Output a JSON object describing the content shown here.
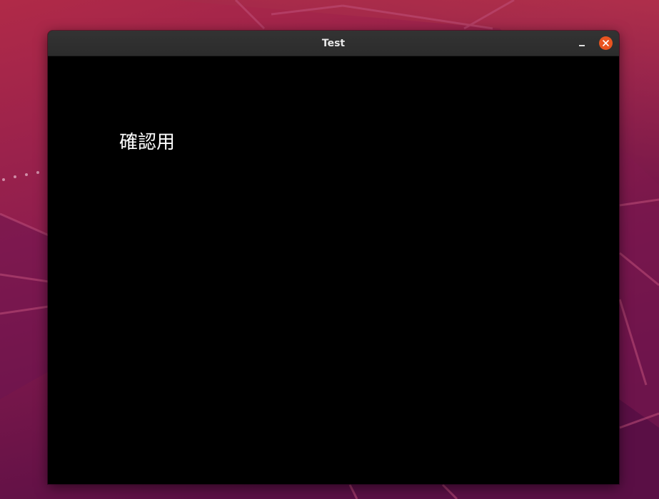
{
  "window": {
    "title": "Test",
    "label": "確認用"
  },
  "titlebar_controls": {
    "minimize_icon": "minimize-icon",
    "close_icon": "close-icon",
    "close_color": "#e95420"
  },
  "theme": {
    "desktop_background": "#8a1c47",
    "window_background": "#000000",
    "titlebar_background": "#2f2f2f",
    "text_color": "#ffffff"
  }
}
